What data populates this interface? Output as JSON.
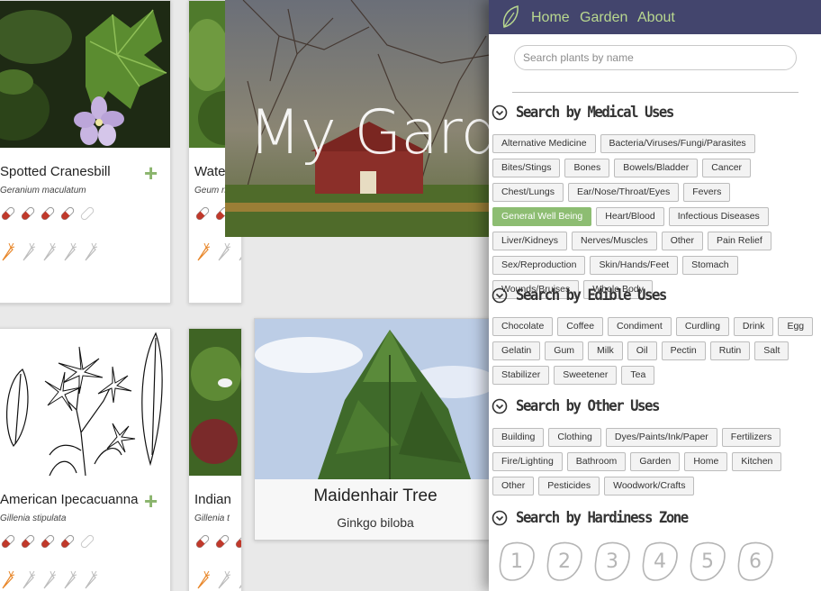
{
  "cards": [
    {
      "name": "Spotted Cranesbill",
      "latin": "Geranium maculatum"
    },
    {
      "name": "Wate",
      "latin": "Geum riv"
    },
    {
      "name": "American Ipecacuanna",
      "latin": "Gillenia stipulata"
    },
    {
      "name": "Indian",
      "latin": "Gillenia t"
    }
  ],
  "hero": {
    "title": "My Garde"
  },
  "featured": {
    "name": "Maidenhair Tree",
    "latin": "Ginkgo biloba"
  },
  "nav": {
    "home": "Home",
    "garden": "Garden",
    "about": "About"
  },
  "search": {
    "placeholder": "Search plants by name",
    "value": ""
  },
  "sections": {
    "medical": {
      "title": "Search by Medical Uses",
      "tags": [
        "Alternative Medicine",
        "Bacteria/Viruses/Fungi/Parasites",
        "Bites/Stings",
        "Bones",
        "Bowels/Bladder",
        "Cancer",
        "Chest/Lungs",
        "Ear/Nose/Throat/Eyes",
        "Fevers",
        "General Well Being",
        "Heart/Blood",
        "Infectious Diseases",
        "Liver/Kidneys",
        "Nerves/Muscles",
        "Other",
        "Pain Relief",
        "Sex/Reproduction",
        "Skin/Hands/Feet",
        "Stomach",
        "Wounds/Bruises",
        "Whole Body"
      ],
      "active": "General Well Being"
    },
    "edible": {
      "title": "Search by Edible Uses",
      "tags": [
        "Chocolate",
        "Coffee",
        "Condiment",
        "Curdling",
        "Drink",
        "Egg",
        "Gelatin",
        "Gum",
        "Milk",
        "Oil",
        "Pectin",
        "Rutin",
        "Salt",
        "Stabilizer",
        "Sweetener",
        "Tea"
      ]
    },
    "other": {
      "title": "Search by Other Uses",
      "tags": [
        "Building",
        "Clothing",
        "Dyes/Paints/Ink/Paper",
        "Fertilizers",
        "Fire/Lighting",
        "Bathroom",
        "Garden",
        "Home",
        "Kitchen",
        "Other",
        "Pesticides",
        "Woodwork/Crafts"
      ]
    },
    "hardiness": {
      "title": "Search by Hardiness Zone",
      "zones": [
        "1",
        "2",
        "3",
        "4",
        "5",
        "6"
      ]
    }
  },
  "colors": {
    "navbar": "#43456d",
    "nav_link": "#b9d88f",
    "active_tag": "#8dbd72",
    "plus": "#8ab46c",
    "pill_red": "#c0392b",
    "carrot_orange": "#e8872b"
  }
}
